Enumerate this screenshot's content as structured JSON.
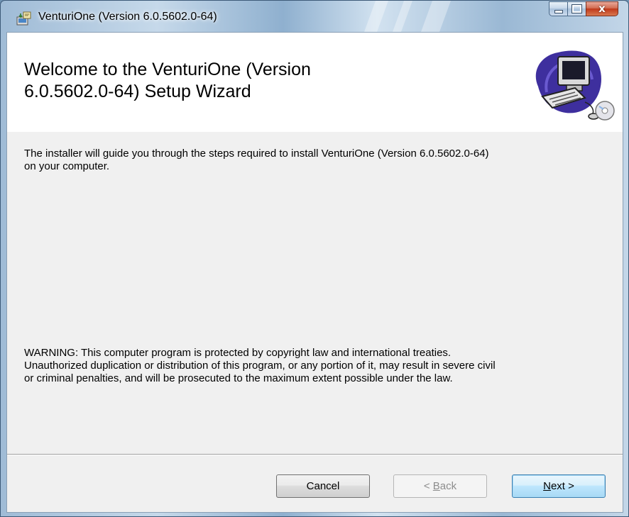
{
  "window": {
    "title": "VenturiOne (Version 6.0.5602.0-64)",
    "close_glyph": "x"
  },
  "banner": {
    "heading_line1": "Welcome to the VenturiOne (Version",
    "heading_line2": "6.0.5602.0-64) Setup Wizard"
  },
  "body": {
    "intro_line1": "The installer will guide you through the steps required to install VenturiOne (Version 6.0.5602.0-64)",
    "intro_line2": "on your computer.",
    "warning_line1": "WARNING: This computer program is protected by copyright law and international treaties.",
    "warning_line2": "Unauthorized duplication or distribution of this program, or any portion of it, may result in severe civil",
    "warning_line3": "or criminal penalties, and will be prosecuted to the maximum extent possible under the law."
  },
  "buttons": {
    "cancel": "Cancel",
    "back_prefix": "< ",
    "back_mnemonic": "B",
    "back_rest": "ack",
    "next_mnemonic": "N",
    "next_rest": "ext >"
  },
  "colors": {
    "accent": "#3c7fb1",
    "close_button": "#c0391b",
    "dialog_bg": "#f0f0f0"
  }
}
